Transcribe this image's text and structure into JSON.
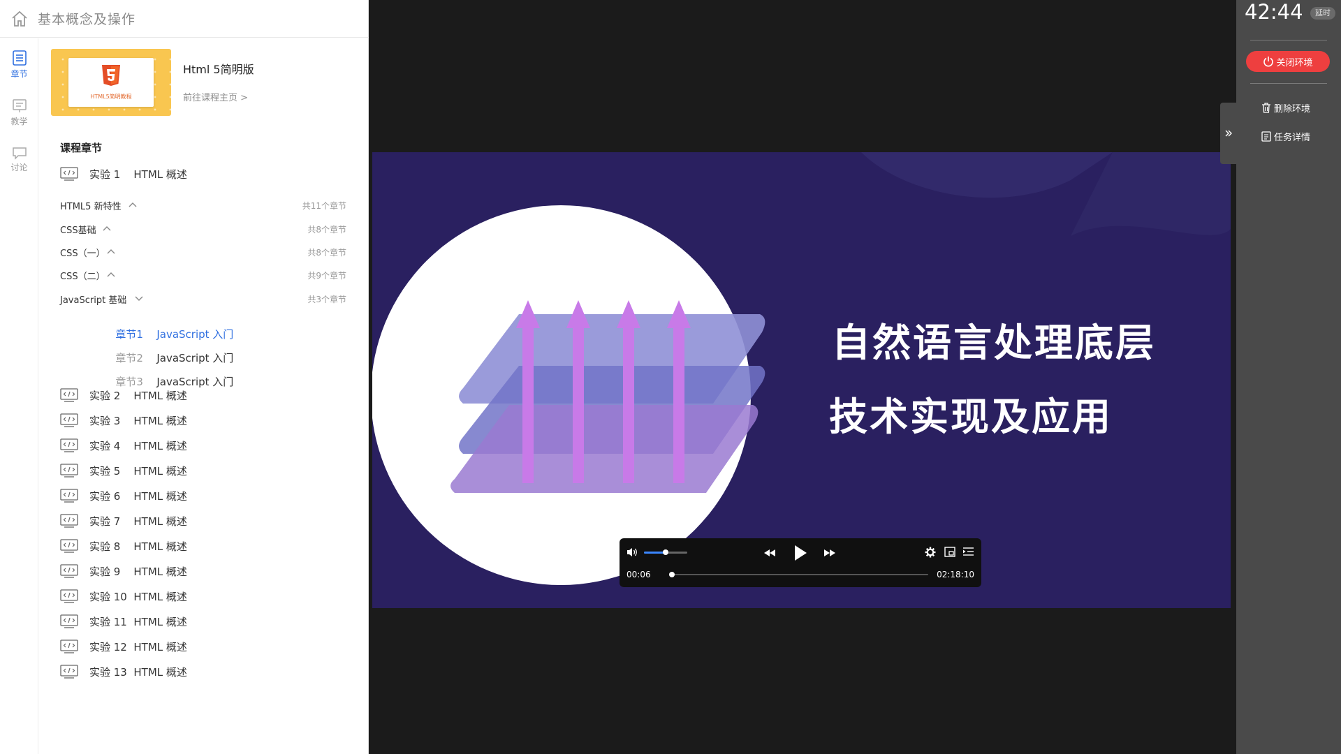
{
  "header": {
    "title": "基本概念及操作"
  },
  "rail": [
    {
      "label": "章节",
      "icon": "chapter-icon",
      "active": true
    },
    {
      "label": "教学",
      "icon": "teaching-icon",
      "active": false
    },
    {
      "label": "讨论",
      "icon": "discussion-icon",
      "active": false
    }
  ],
  "course": {
    "name": "Html 5简明版",
    "link": "前往课程主页 >",
    "thumb_caption": "HTML5简明教程"
  },
  "sidebar": {
    "heading": "课程章节",
    "first_lab": "实验 1    HTML 概述",
    "groups": [
      {
        "name": "HTML5 新特性",
        "count": "共11个章节",
        "expanded": false
      },
      {
        "name": "CSS基础",
        "count": "共8个章节",
        "expanded": false
      },
      {
        "name": "CSS（一）",
        "count": "共8个章节",
        "expanded": false
      },
      {
        "name": "CSS（二）",
        "count": "共9个章节",
        "expanded": false
      },
      {
        "name": "JavaScript 基础",
        "count": "共3个章节",
        "expanded": true
      }
    ],
    "subsections": [
      {
        "no": "章节1",
        "name": "JavaScript 入门",
        "active": true
      },
      {
        "no": "章节2",
        "name": "JavaScript 入门",
        "active": false
      },
      {
        "no": "章节3",
        "name": "JavaScript 入门",
        "active": false
      }
    ],
    "labs": [
      "实验 2    HTML 概述",
      "实验 3    HTML 概述",
      "实验 4    HTML 概述",
      "实验 5    HTML 概述",
      "实验 6    HTML 概述",
      "实验 7    HTML 概述",
      "实验 8    HTML 概述",
      "实验 9    HTML 概述",
      "实验 10  HTML 概述",
      "实验 11  HTML 概述",
      "实验 12  HTML 概述",
      "实验 13  HTML 概述"
    ]
  },
  "video": {
    "title_line1": "自然语言处理底层",
    "title_line2": "技术实现及应用",
    "current_time": "00:06",
    "total_time": "02:18:10",
    "volume": 0.5,
    "progress": 0.0008
  },
  "right_panel": {
    "timer": "42:44",
    "extend_label": "延时",
    "close_env": "关闭环境",
    "delete_env": "删除环境",
    "task_detail": "任务详情"
  },
  "colors": {
    "accent": "#2f6fe0",
    "danger": "#ee3f3f",
    "video_bg": "#2a2060",
    "panel_dark": "#4a4a4a"
  }
}
